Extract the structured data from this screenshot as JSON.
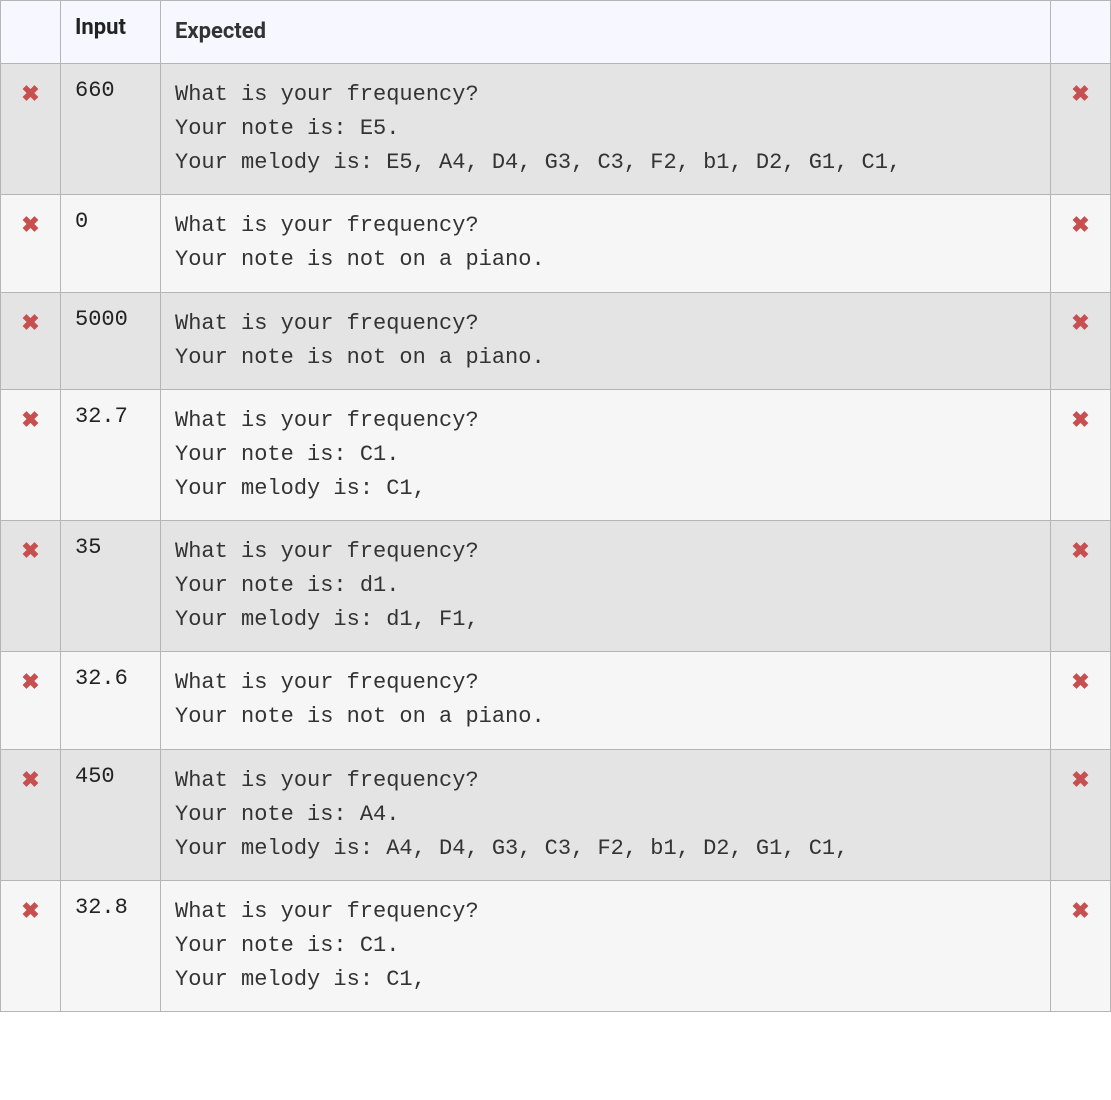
{
  "table": {
    "headers": {
      "status_left": "",
      "input": "Input",
      "expected": "Expected",
      "status_right": ""
    },
    "fail_glyph": "✖",
    "rows": [
      {
        "status_left": "fail",
        "input": "660",
        "expected": "What is your frequency?\nYour note is: E5.\nYour melody is: E5, A4, D4, G3, C3, F2, b1, D2, G1, C1,",
        "status_right": "fail"
      },
      {
        "status_left": "fail",
        "input": "0",
        "expected": "What is your frequency?\nYour note is not on a piano.",
        "status_right": "fail"
      },
      {
        "status_left": "fail",
        "input": "5000",
        "expected": "What is your frequency?\nYour note is not on a piano.",
        "status_right": "fail"
      },
      {
        "status_left": "fail",
        "input": "32.7",
        "expected": "What is your frequency?\nYour note is: C1.\nYour melody is: C1,",
        "status_right": "fail"
      },
      {
        "status_left": "fail",
        "input": "35",
        "expected": "What is your frequency?\nYour note is: d1.\nYour melody is: d1, F1,",
        "status_right": "fail"
      },
      {
        "status_left": "fail",
        "input": "32.6",
        "expected": "What is your frequency?\nYour note is not on a piano.",
        "status_right": "fail"
      },
      {
        "status_left": "fail",
        "input": "450",
        "expected": "What is your frequency?\nYour note is: A4.\nYour melody is: A4, D4, G3, C3, F2, b1, D2, G1, C1,",
        "status_right": "fail"
      },
      {
        "status_left": "fail",
        "input": "32.8",
        "expected": "What is your frequency?\nYour note is: C1.\nYour melody is: C1,",
        "status_right": "fail"
      }
    ]
  }
}
